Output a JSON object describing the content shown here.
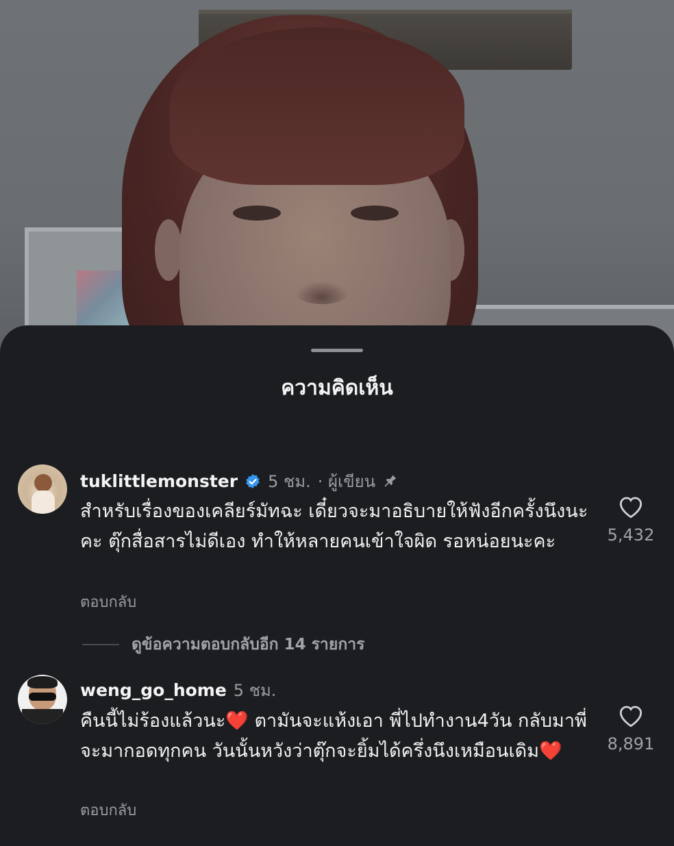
{
  "sheet": {
    "title": "ความคิดเห็น"
  },
  "comments": [
    {
      "username": "tuklittlemonster",
      "verified": true,
      "time": "5 ชม.",
      "author_tag": "· ผู้เขียน",
      "pinned": true,
      "text": "สำหรับเรื่องของเคลียร์มัทฉะ เดี๋ยวจะมาอธิบายให้ฟังอีกครั้งนึงนะคะ ตุ๊กสื่อสารไม่ดีเอง ทำให้หลายคนเข้าใจผิด รอหน่อยนะคะ",
      "reply_label": "ตอบกลับ",
      "likes": "5,432",
      "view_replies": "ดูข้อความตอบกลับอีก 14 รายการ"
    },
    {
      "username": "weng_go_home",
      "verified": false,
      "time": "5 ชม.",
      "text": "คืนนี้ไม่ร้องแล้วนะ❤️ ตามันจะแห้งเอา พี่ไปทำงาน4วัน กลับมาพี่จะมากอดทุกคน วันนั้นหวังว่าตุ๊กจะยิ้มได้ครึ่งนึงเหมือนเดิม❤️",
      "reply_label": "ตอบกลับ",
      "likes": "8,891"
    }
  ],
  "colors": {
    "sheet_bg": "#1b1d20",
    "verified_blue": "#3797f0",
    "secondary_text": "#9a9da1"
  },
  "icons": [
    "verified-badge-icon",
    "pin-icon",
    "heart-icon"
  ]
}
